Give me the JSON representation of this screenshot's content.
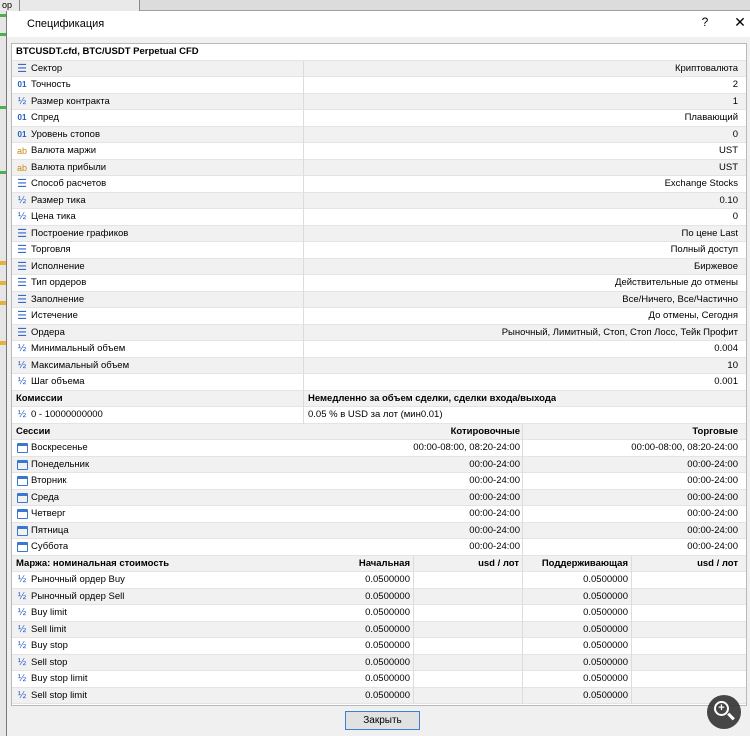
{
  "background": {
    "tab_label": "ор"
  },
  "dialog": {
    "title": "Спецификация",
    "help_glyph": "?",
    "close_glyph": "✕",
    "symbol_title": "BTCUSDT.cfd, BTC/USDT Perpetual CFD",
    "close_button": "Закрыть"
  },
  "properties": [
    {
      "icon": "list-icon",
      "label": "Сектор",
      "value": "Криптовалюта"
    },
    {
      "icon": "number-icon",
      "label": "Точность",
      "value": "2"
    },
    {
      "icon": "fraction-icon",
      "label": "Размер контракта",
      "value": "1"
    },
    {
      "icon": "number-icon",
      "label": "Спред",
      "value": "Плавающий"
    },
    {
      "icon": "number-icon",
      "label": "Уровень стопов",
      "value": "0"
    },
    {
      "icon": "text-icon",
      "label": "Валюта маржи",
      "value": "UST"
    },
    {
      "icon": "text-icon",
      "label": "Валюта прибыли",
      "value": "UST"
    },
    {
      "icon": "list-icon",
      "label": "Способ расчетов",
      "value": "Exchange Stocks"
    },
    {
      "icon": "fraction-icon",
      "label": "Размер тика",
      "value": "0.10"
    },
    {
      "icon": "fraction-icon",
      "label": "Цена тика",
      "value": "0"
    },
    {
      "icon": "list-icon",
      "label": "Построение графиков",
      "value": "По цене Last"
    },
    {
      "icon": "list-icon",
      "label": "Торговля",
      "value": "Полный доступ"
    },
    {
      "icon": "list-icon",
      "label": "Исполнение",
      "value": "Биржевое"
    },
    {
      "icon": "list-icon",
      "label": "Тип ордеров",
      "value": "Действительные до отмены"
    },
    {
      "icon": "list-icon",
      "label": "Заполнение",
      "value": "Все/Ничего, Все/Частично"
    },
    {
      "icon": "list-icon",
      "label": "Истечение",
      "value": "До отмены, Сегодня"
    },
    {
      "icon": "list-icon",
      "label": "Ордера",
      "value": "Рыночный, Лимитный, Стоп, Стоп Лосс, Тейк Профит"
    },
    {
      "icon": "fraction-icon",
      "label": "Минимальный объем",
      "value": "0.004"
    },
    {
      "icon": "fraction-icon",
      "label": "Максимальный объем",
      "value": "10"
    },
    {
      "icon": "fraction-icon",
      "label": "Шаг объема",
      "value": "0.001"
    }
  ],
  "commissions": {
    "header": "Комиссии",
    "description": "Немедленно за объем сделки, сделки входа/выхода",
    "range": "0 - 10000000000",
    "rate": "0.05 % в USD за лот (мин0.01)"
  },
  "sessions": {
    "header": "Сессии",
    "col_quotes": "Котировочные",
    "col_trade": "Торговые",
    "days": [
      {
        "day": "Воскресенье",
        "quotes": "00:00-08:00, 08:20-24:00",
        "trade": "00:00-08:00, 08:20-24:00"
      },
      {
        "day": "Понедельник",
        "quotes": "00:00-24:00",
        "trade": "00:00-24:00"
      },
      {
        "day": "Вторник",
        "quotes": "00:00-24:00",
        "trade": "00:00-24:00"
      },
      {
        "day": "Среда",
        "quotes": "00:00-24:00",
        "trade": "00:00-24:00"
      },
      {
        "day": "Четверг",
        "quotes": "00:00-24:00",
        "trade": "00:00-24:00"
      },
      {
        "day": "Пятница",
        "quotes": "00:00-24:00",
        "trade": "00:00-24:00"
      },
      {
        "day": "Суббота",
        "quotes": "00:00-24:00",
        "trade": "00:00-24:00"
      }
    ]
  },
  "margin": {
    "header": "Маржа: номинальная стоимость",
    "col_initial": "Начальная",
    "col_unit1": "usd / лот",
    "col_maint": "Поддерживающая",
    "col_unit2": "usd / лот",
    "rows": [
      {
        "type": "Рыночный ордер Buy",
        "initial": "0.0500000",
        "maint": "0.0500000"
      },
      {
        "type": "Рыночный ордер Sell",
        "initial": "0.0500000",
        "maint": "0.0500000"
      },
      {
        "type": "Buy limit",
        "initial": "0.0500000",
        "maint": "0.0500000"
      },
      {
        "type": "Sell limit",
        "initial": "0.0500000",
        "maint": "0.0500000"
      },
      {
        "type": "Buy stop",
        "initial": "0.0500000",
        "maint": "0.0500000"
      },
      {
        "type": "Sell stop",
        "initial": "0.0500000",
        "maint": "0.0500000"
      },
      {
        "type": "Buy stop limit",
        "initial": "0.0500000",
        "maint": "0.0500000"
      },
      {
        "type": "Sell stop limit",
        "initial": "0.0500000",
        "maint": "0.0500000"
      }
    ]
  }
}
